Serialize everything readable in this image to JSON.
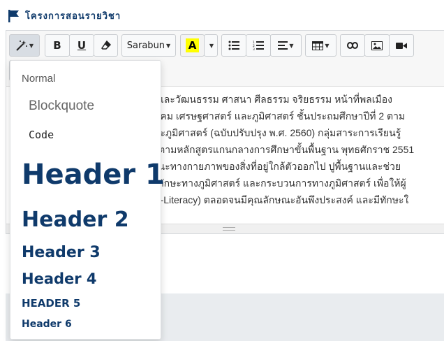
{
  "section": {
    "title": "โครงการสอนรายวิชา"
  },
  "toolbar": {
    "font_name": "Sarabun",
    "highlight_letter": "A",
    "highlight_color": "#ffff00"
  },
  "content": {
    "lines": [
      "า และวัฒนธรรม ศาสนา ศีลธรรม จริยธรรม หน้าที่พลเมือง",
      "สังคม เศรษฐศาสตร์ และภูมิศาสตร์ ชั้นประถมศึกษาปีที่ 2 ตาม",
      "าระภูมิศาสตร์ (ฉบับปรับปรุง พ.ศ. 2560) กลุ่มสาระการเรียนรู้",
      "ม ตามหลักสูตรแกนกลางการศึกษาขั้นพื้นฐาน พุทธศักราช 2551",
      "ษณะทางกายภาพของสิ่งที่อยู่ใกล้ตัวออกไป ปูพื้นฐานและช่วย",
      "ร์ ทักษะทางภูมิศาสตร์ และกระบวนการทางภูมิศาสตร์ เพื่อให้ผู้",
      "eo-Literacy) ตลอดจนมีคุณลักษณะอันพึงประสงค์ และมีทักษะใ"
    ]
  },
  "style_menu": {
    "normal": "Normal",
    "blockquote": "Blockquote",
    "code": "Code",
    "h1": "Header 1",
    "h2": "Header 2",
    "h3": "Header 3",
    "h4": "Header 4",
    "h5": "HEADER 5",
    "h6": "Header 6"
  },
  "colors": {
    "brand_navy": "#0f3a6b",
    "toolbar_bg": "#f7f7f7",
    "footer_bg": "#e9ecef"
  }
}
